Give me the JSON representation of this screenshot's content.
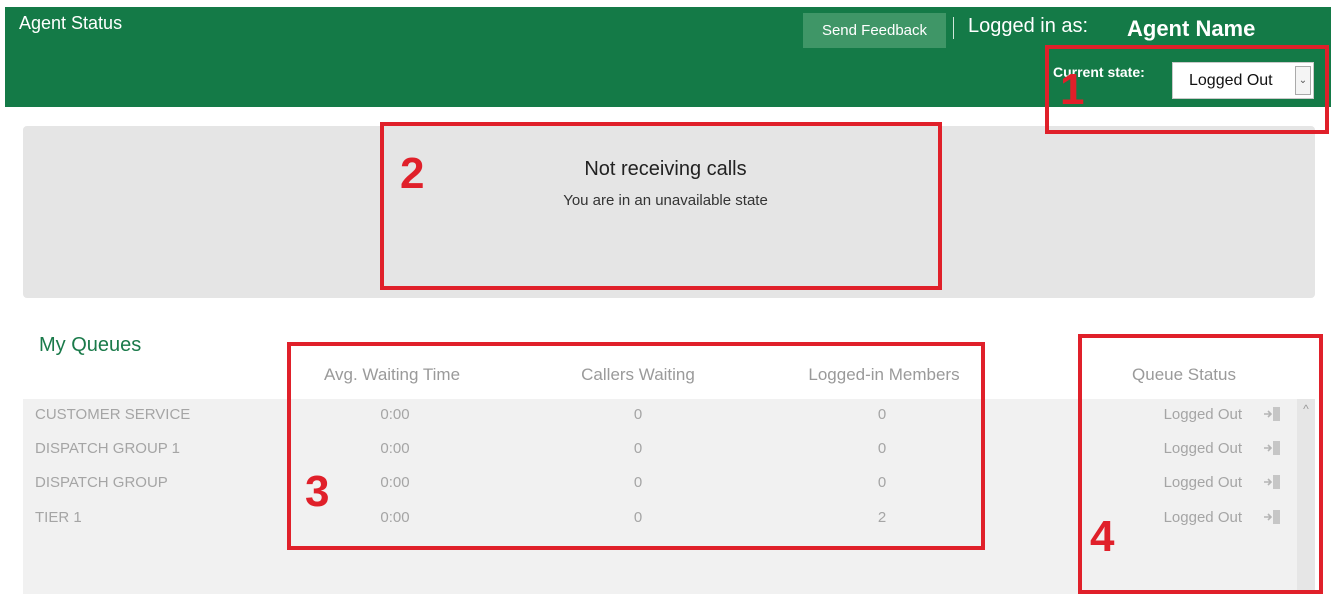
{
  "header": {
    "title": "Agent Status",
    "feedback_label": "Send Feedback",
    "logged_in_label": "Logged in as:",
    "agent_name": "Agent Name",
    "state_label": "Current state:",
    "state_value": "Logged Out"
  },
  "status": {
    "title": "Not receiving calls",
    "subtitle": "You are in an unavailable state"
  },
  "queues": {
    "title": "My Queues",
    "columns": {
      "avg_wait": "Avg. Waiting Time",
      "callers": "Callers Waiting",
      "members": "Logged-in Members",
      "status": "Queue Status"
    },
    "rows": [
      {
        "name": "CUSTOMER SERVICE",
        "avg_wait": "0:00",
        "callers": "0",
        "members": "0",
        "status": "Logged Out"
      },
      {
        "name": "DISPATCH GROUP 1",
        "avg_wait": "0:00",
        "callers": "0",
        "members": "0",
        "status": "Logged Out"
      },
      {
        "name": "DISPATCH GROUP",
        "avg_wait": "0:00",
        "callers": "0",
        "members": "0",
        "status": "Logged Out"
      },
      {
        "name": "TIER 1",
        "avg_wait": "0:00",
        "callers": "0",
        "members": "2",
        "status": "Logged Out"
      }
    ]
  },
  "annotations": [
    "1",
    "2",
    "3",
    "4"
  ],
  "colors": {
    "brand": "#147a47",
    "annotation": "#e0202a"
  }
}
